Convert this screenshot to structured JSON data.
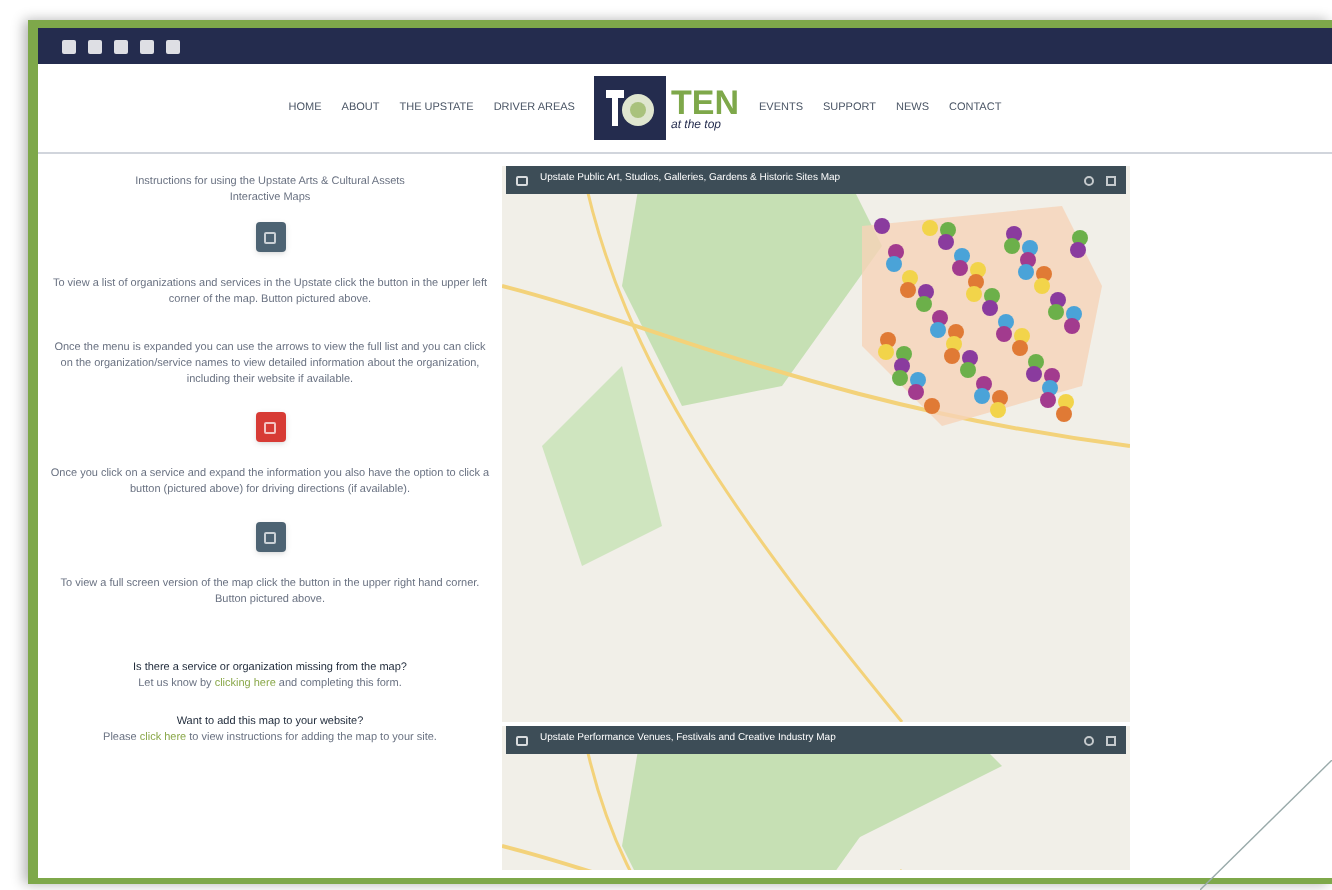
{
  "nav": {
    "left": [
      "HOME",
      "ABOUT",
      "THE UPSTATE",
      "DRIVER AREAS"
    ],
    "logo": {
      "main": "TEN",
      "sub": "at the top"
    },
    "right": [
      "EVENTS",
      "SUPPORT",
      "NEWS",
      "CONTACT"
    ]
  },
  "instructions": [
    {
      "kind": "heading",
      "text": "Instructions for using the Upstate Arts & Cultural Assets Interactive Maps"
    },
    {
      "kind": "button",
      "color": "#4d6373"
    },
    {
      "kind": "text",
      "text": "To view a list of organizations and services in the Upstate click the button in the upper left corner of the map. Button pictured above."
    },
    {
      "kind": "text",
      "text": "Once the menu is expanded you can use the arrows to view the full list and you can click on the organization/service names to view detailed information about the organization, including their website if available."
    },
    {
      "kind": "button",
      "color": "#d73b35"
    },
    {
      "kind": "text",
      "text": "Once you click on a service and expand the information you also have the option to click a button (pictured above) for driving directions (if available)."
    },
    {
      "kind": "button",
      "color": "#4d6373"
    },
    {
      "kind": "text",
      "text": "To view a full screen version of the map click the button in the upper right hand corner. Button pictured above."
    }
  ],
  "links": [
    {
      "question": "Is there a service or organization missing from the map?",
      "before": "Let us know by ",
      "link": "clicking here",
      "after": " and completing this form."
    },
    {
      "question": "Want to add this map to your website?",
      "before": "Please ",
      "link": "click here",
      "after": " to view instructions for adding the map to your site."
    }
  ],
  "maps": [
    {
      "title": "Upstate Public Art, Studios, Galleries, Gardens & Historic Sites Map",
      "kind": "picture"
    },
    {
      "title": "Upstate Performance Venues, Festivals and Creative Industry Map",
      "kind": "picture"
    }
  ]
}
